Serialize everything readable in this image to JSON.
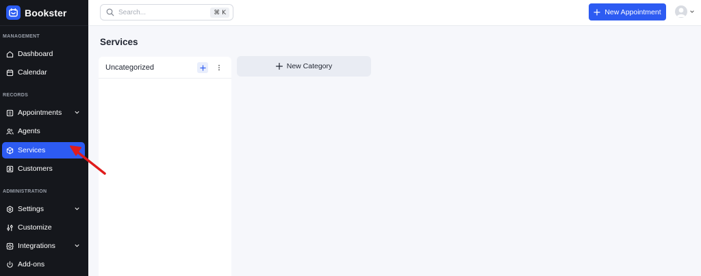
{
  "app": {
    "name": "Bookster",
    "brand_color": "#2d5bf2"
  },
  "sidebar": {
    "sections": [
      {
        "label": "MANAGEMENT",
        "items": [
          {
            "label": "Dashboard",
            "icon": "home-icon"
          },
          {
            "label": "Calendar",
            "icon": "calendar-icon"
          }
        ]
      },
      {
        "label": "RECORDS",
        "items": [
          {
            "label": "Appointments",
            "icon": "appointments-icon",
            "expandable": true
          },
          {
            "label": "Agents",
            "icon": "users-icon"
          },
          {
            "label": "Services",
            "icon": "cube-icon",
            "active": true
          },
          {
            "label": "Customers",
            "icon": "contact-icon"
          }
        ]
      },
      {
        "label": "ADMINISTRATION",
        "items": [
          {
            "label": "Settings",
            "icon": "gear-icon",
            "expandable": true
          },
          {
            "label": "Customize",
            "icon": "sliders-icon"
          },
          {
            "label": "Integrations",
            "icon": "integrations-icon",
            "expandable": true
          },
          {
            "label": "Add-ons",
            "icon": "plug-icon"
          }
        ]
      }
    ]
  },
  "topbar": {
    "search_placeholder": "Search...",
    "search_shortcut": "⌘ K",
    "new_appointment_label": "New Appointment"
  },
  "main": {
    "title": "Services",
    "categories": [
      {
        "name": "Uncategorized"
      }
    ],
    "new_category_label": "New Category"
  },
  "annotation": {
    "color": "#e01b1b"
  }
}
